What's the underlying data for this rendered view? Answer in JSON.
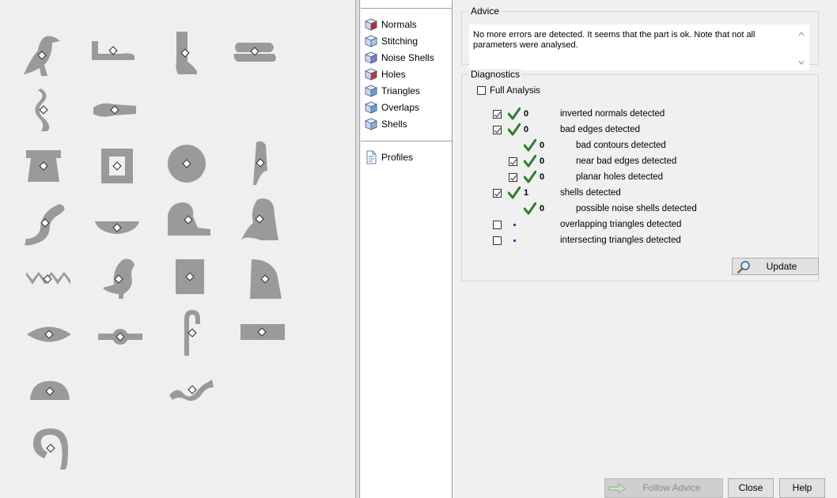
{
  "categories": {
    "items": [
      {
        "label": "Normals",
        "icon": "normals-cube-icon"
      },
      {
        "label": "Stitching",
        "icon": "stitching-cube-icon"
      },
      {
        "label": "Noise Shells",
        "icon": "noise-shells-cube-icon"
      },
      {
        "label": "Holes",
        "icon": "holes-cube-icon"
      },
      {
        "label": "Triangles",
        "icon": "triangles-cube-icon"
      },
      {
        "label": "Overlaps",
        "icon": "overlaps-cube-icon"
      },
      {
        "label": "Shells",
        "icon": "shells-cube-icon"
      }
    ],
    "profiles_label": "Profiles"
  },
  "advice": {
    "title": "Advice",
    "text": "No more errors are detected. It seems that the part is ok. Note that not all parameters were analysed."
  },
  "diagnostics": {
    "title": "Diagnostics",
    "full_analysis_label": "Full Analysis",
    "full_analysis_checked": false,
    "rows": [
      {
        "checked": true,
        "status": "ok",
        "count": "0",
        "label": "inverted normals detected"
      },
      {
        "checked": true,
        "status": "ok",
        "count": "0",
        "label": "bad edges detected"
      },
      {
        "checked": null,
        "status": "ok",
        "count": "0",
        "label": "bad contours detected"
      },
      {
        "checked": true,
        "status": "ok",
        "count": "0",
        "label": "near bad edges detected"
      },
      {
        "checked": true,
        "status": "ok",
        "count": "0",
        "label": "planar holes detected"
      },
      {
        "checked": true,
        "status": "ok",
        "count": "1",
        "label": "shells detected"
      },
      {
        "checked": null,
        "status": "ok",
        "count": "0",
        "label": "possible noise shells detected"
      },
      {
        "checked": false,
        "status": "pending",
        "count": "",
        "label": "overlapping triangles detected"
      },
      {
        "checked": false,
        "status": "pending",
        "count": "",
        "label": "intersecting triangles detected"
      }
    ],
    "update_label": "Update"
  },
  "footer": {
    "follow_advice_label": "Follow Advice",
    "close_label": "Close",
    "help_label": "Help"
  },
  "colors": {
    "check_green": "#2e7d32",
    "pending_dot": "#1a3aa0",
    "part_gray": "#9a9a9a"
  },
  "viewport": {
    "parts": [
      "vulture-hieroglyph-part",
      "arm-hieroglyph-part",
      "leg-hieroglyph-part",
      "hobble-hieroglyph-part",
      "twisted-flax-hieroglyph-part",
      "hand-hieroglyph-part",
      "stool-hieroglyph-part",
      "courtyard-hieroglyph-part",
      "placenta-disk-hieroglyph-part",
      "reed-leaf-hieroglyph-part",
      "cobra-hieroglyph-part",
      "basket-hieroglyph-part",
      "lion-hieroglyph-part",
      "owl-hieroglyph-part",
      "water-ripple-hieroglyph-part",
      "quail-chick-hieroglyph-part",
      "door-bolt-hieroglyph-part",
      "hill-slope-hieroglyph-part",
      "mouth-hieroglyph-part",
      "tie-knot-hieroglyph-part",
      "crook-hieroglyph-part",
      "door-plank-hieroglyph-part",
      "bread-loaf-hieroglyph-part",
      "horned-viper-hieroglyph-part",
      "tethering-rope-hieroglyph-part"
    ]
  }
}
